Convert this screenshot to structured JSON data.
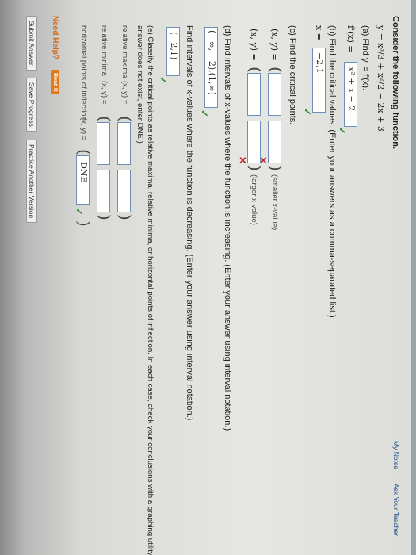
{
  "window": {
    "top_notice": "…"
  },
  "header": {
    "my_notes": "My Notes",
    "ask_teacher": "Ask Your Teacher"
  },
  "problem": {
    "intro": "Consider the following function.",
    "function": "y = x³/3 + x²/2 − 2x + 3",
    "part_a": {
      "label": "(a) Find y' = f'(x).",
      "prefix": "f'(x) =",
      "answer": "x² + x − 2"
    },
    "part_b": {
      "label": "(b) Find the critical values. (Enter your answers as a comma-separated list.)",
      "prefix": "x =",
      "answer": "−2,1"
    },
    "part_c": {
      "label": "(c) Find the critical points.",
      "row1_prefix": "(x, y) =",
      "row1_hint": "(smaller x-value)",
      "row2_prefix": "(x, y) =",
      "row2_hint": "(larger x-value)"
    },
    "part_d": {
      "label": "(d) Find intervals of x-values where the function is increasing. (Enter your answer using interval notation.)",
      "answer1": "(−∞, −2),(1,∞)",
      "label2": "Find intervals of x-values where the function is decreasing. (Enter your answer using interval notation.)",
      "answer2": "(−2,1)"
    },
    "part_e": {
      "label": "(e) Classify the critical points as relative maxima, relative minima, or horizontal points of inflection. In each case, check your conclusions with a graphing utility. (If an",
      "label_cont": "answer does not exist, enter DNE.)",
      "rel_max": "relative maxima",
      "rel_min": "relative minima",
      "hpoi": "horizontal points of inflection",
      "xy": "(x, y) =",
      "hpoi_answer": "DNE"
    }
  },
  "help": {
    "need_help": "Need Help?",
    "read_it": "Read It"
  },
  "footer": {
    "submit": "Submit Answer",
    "save": "Save Progress",
    "practice": "Practice Another Version"
  },
  "colors": {
    "check": "#2e8b2e",
    "x": "#c0222a",
    "link": "#1a4d8a",
    "help": "#d46a1a"
  }
}
